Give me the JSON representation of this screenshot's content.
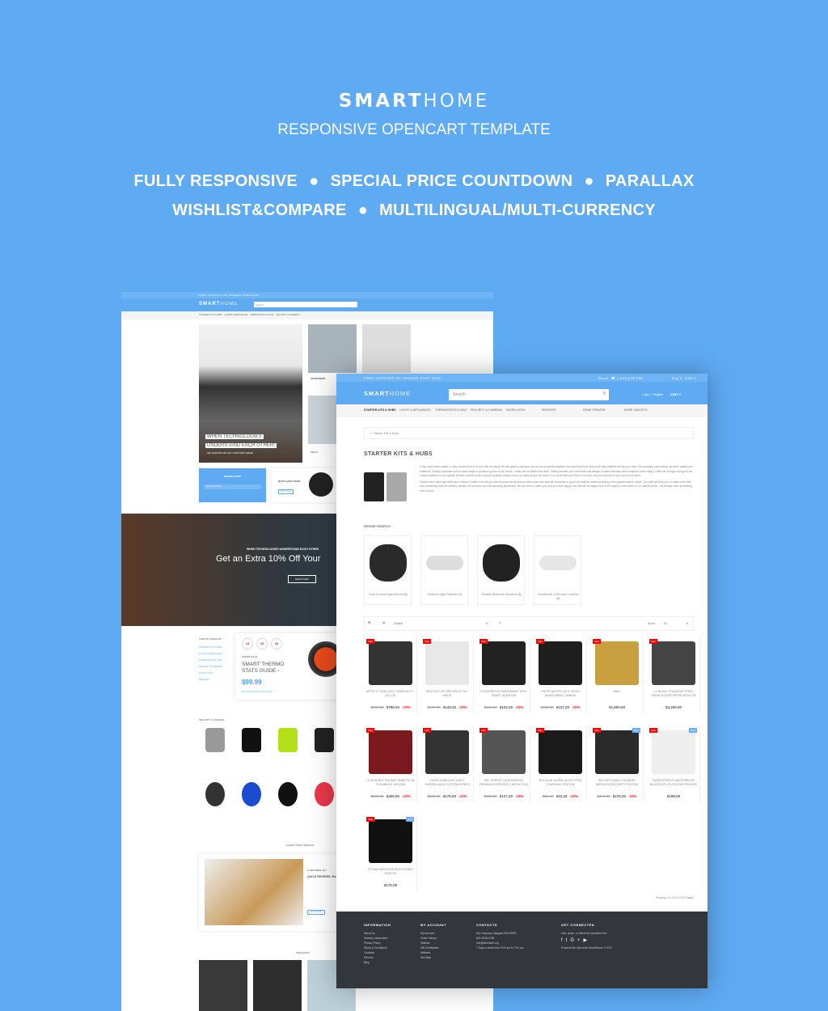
{
  "promo": {
    "brand_bold": "SMART",
    "brand_light": "HOME",
    "subtitle": "RESPONSIVE OPENCART TEMPLATE",
    "features_line1": [
      "FULLY RESPONSIVE",
      "SPECIAL PRICE COUNTDOWN",
      "PARALLAX"
    ],
    "features_line2": [
      "WISHLIST&COMPARE",
      "MULTILINGUAL/MULTI-CURRENCY"
    ]
  },
  "colors": {
    "background": "#5eaaf3",
    "header": "#5eaaf3",
    "sale_badge": "#ff0000",
    "new_badge": "#6ab0f3",
    "footer": "#33363b",
    "discount": "#ff2222"
  },
  "store": {
    "shipping": "FREE SHIPPING ON ORDERS OVER $199",
    "email": "Email",
    "phone": "1.345.678.998",
    "lang": "Eng",
    "currency": "USD",
    "logo_bold": "SMART",
    "logo_light": "HOME",
    "search_placeholder": "Search",
    "login": "Login",
    "register": "Register",
    "cart": "CART: 0",
    "nav": [
      "STARTER KITS & HUBS",
      "LIGHTS & APPLIANCES",
      "THERMOSTATS & HVAC",
      "SECURITY & CAMERAS",
      "DOOR LOCKS",
      "SENSORS",
      "HOME THEATER",
      "MORE GADGETS"
    ]
  },
  "front": {
    "breadcrumb": "Starter Kits & Hubs",
    "title": "STARTER KITS & HUBS",
    "desc1": "It has never been easier to shop sweets than it is now with our shop! We are glad to welcome you at our chocolate kingdom and sincerely hope that you'll stay satisfied during your visit. Our company cares about premium quality and traditions. Smiling customers and a wide range of premium goods at fair prices – what can be better than that? Selling candies and chocolate was always a noble business and it requires some magic, a little bit of sugar and good old recipes realized in our sweets. Modern sweets stores cannot replicate unique charm of candy shops but there is no doubt that you'll feel it from the very first second of your visit at our store.",
    "desc2": "Sweets don't have age limits and it doesn't matter how old you are because we all become kids when see favorite chocolate or good old muffins made according to the grandmother's recipe. Our staff will help you to make order fast and seamlessly and the delivery system will surprise you with amazing quickness. We are here to make you and your kids happy. Eat sweets, be happy and don't forget to come back to our sweets store – we always have something new for you!",
    "refine": "REFINE SEARCH",
    "refine_items": [
      "Tools & Home Improvement (8)",
      "Electrical Light Switches (8)",
      "Portable Bluetooth Speakers (8)",
      "Surveillance & Security Cameras (8)"
    ],
    "sort": "Default",
    "show_label": "Show:",
    "show_value": "50",
    "products": [
      {
        "name": "APPLE 9.7 IPAD (2017 128GB WI FI + 4G LTE)",
        "old": "$999.00",
        "price": "$799.20",
        "off": "-20%",
        "badges": [
          "Sale"
        ],
        "color": "#333"
      },
      {
        "name": "BEATS BY DR DRE BEATS PILL WHITE",
        "old": "$179.00",
        "price": "$143.20",
        "off": "-20%",
        "badges": [
          "Sale"
        ],
        "color": "#e8e8e8"
      },
      {
        "name": "COUNTERTOP MICROWAVE WITH SMART INVERTER",
        "old": "$129.00",
        "price": "$103.20",
        "off": "-20%",
        "badges": [
          "Sale"
        ],
        "color": "#222"
      },
      {
        "name": "DROPCAM PRO WI FI VIDEO MONITORING CAMERA",
        "old": "$159.00",
        "price": "$127.20",
        "off": "-20%",
        "badges": [
          "Sale"
        ],
        "color": "#1e1e1e"
      },
      {
        "name": "IMAC",
        "old": "",
        "price": "$1,600.00",
        "off": "",
        "badges": [
          "Sale"
        ],
        "color": "#c8a040"
      },
      {
        "name": "LG BLACK STAINLESS STEEL FRENCH DOOR REFRIGERATOR",
        "old": "",
        "price": "$3,200.00",
        "off": "",
        "badges": [
          "Sale"
        ],
        "color": "#444"
      },
      {
        "name": "LG HOM BOT SQUARE ROBOTIC WI FI ENABLED VACUUM",
        "old": "$500.00",
        "price": "$400.00",
        "off": "-20%",
        "badges": [
          "Sale"
        ],
        "color": "#7a1a1e"
      },
      {
        "name": "LOREX WIRELESS VIDEO SURVEILLANCE SYSTEM SERIES",
        "old": "$220.00",
        "price": "$176.00",
        "off": "-20%",
        "badges": [
          "Sale"
        ],
        "color": "#333"
      },
      {
        "name": "MR. COFFEE CAFÉ BARISTA PREMIUM ESPRESSO CAPPUCCINO",
        "old": "$159.00",
        "price": "$127.20",
        "off": "-20%",
        "badges": [
          "Sale"
        ],
        "color": "#555"
      },
      {
        "name": "RCA DUAL ALARM CLOCK IPOD CHARGING STATION",
        "old": "$28.00",
        "price": "$22.40",
        "off": "-20%",
        "badges": [
          "Sale"
        ],
        "color": "#1a1a1a"
      },
      {
        "name": "SECURITYMAN 4 CHANNEL WIRELESS SECURITY SYSTEM",
        "old": "$349.00",
        "price": "$279.20",
        "off": "-20%",
        "badges": [
          "Sale",
          "New"
        ],
        "color": "#2a2a2a"
      },
      {
        "name": "SMARTSPEED® WATERPROOF BLUETOOTH OUTDOOR SPEAKER",
        "old": "",
        "price": "$199.00",
        "off": "",
        "badges": [
          "Sale",
          "New"
        ],
        "color": "#eee"
      },
      {
        "name": "TP LINK WIRELESS WI FI GIGABIT ROUTER",
        "old": "",
        "price": "$170.00",
        "off": "",
        "badges": [
          "Sale",
          "New"
        ],
        "color": "#111"
      }
    ],
    "showing": "Showing 1 to 13 of 13 (1 Pages)"
  },
  "footer": {
    "info_title": "INFORMATION",
    "info": [
      "About Us",
      "Delivery Information",
      "Privacy Policy",
      "Terms & Conditions",
      "Contacts",
      "Returns",
      "Blog"
    ],
    "account_title": "MY ACCOUNT",
    "account": [
      "My Account",
      "Order History",
      "Wishlist",
      "Gift Certificates",
      "Affiliates",
      "Site Map"
    ],
    "contacts_title": "CONTACTS",
    "contacts": [
      "My Company Glasgow D04 89GR",
      "800-2345-6789",
      "info@demolink.org",
      "7 Days a week from 9:00 am to 7:00 pm"
    ],
    "social_title": "GET CONNECTED",
    "social_text": "Like, share, or follow for exclusive info!",
    "powered": "Powered By OpenCart SmartHome © 2017"
  },
  "back": {
    "banner_line1": "WHEN TECHNOLOGIES",
    "banner_line2": "UNDERSTAND EACH OTHER!",
    "banner_sub": "GET AN EXTRA 10% OFF YOUR FIRST ORDER",
    "apartment": "APARTMENT",
    "villa": "VILLA",
    "from": "From $499.99",
    "newsletter": "NEWSLETTER",
    "newsletter_input": "Enter Your Email",
    "must_have": "MUST HAVE ITEMS",
    "shop_now": "SHOP NOW",
    "parallax_title": "WHEN TECHNOLOGIES UNDERSTAND EACH OTHER",
    "parallax_text": "Get an Extra 10% Off Your",
    "shop_now2": "SHOP NOW",
    "shop_by": "SHOP BY CATEGORY",
    "categories": [
      "STARTER KITS & HUBS",
      "LIGHTS & APPLIANCES",
      "THERMOSTATS & HVAC",
      "SECURITY & CAMERAS",
      "DOOR LOCKS",
      "SENSORS"
    ],
    "countdown": [
      "14",
      "15",
      "34"
    ],
    "super_sale": "SUPER SALE!",
    "deal_title": "SMART THERMO STATS GUIDE -",
    "deal_price": "$99.99",
    "deal_link": "Why Choose a Smart Thermostat?",
    "security": "SECURITY & CAMERAS",
    "blog": "LATEST FROM THE BLOG",
    "blog_date": "12 SEPTEMBER, 2017",
    "blog_title": "QUICK REVIEWS: Monitor, and Sla",
    "read_more": "READ MORE",
    "instagram": "INSTAGRAM"
  }
}
